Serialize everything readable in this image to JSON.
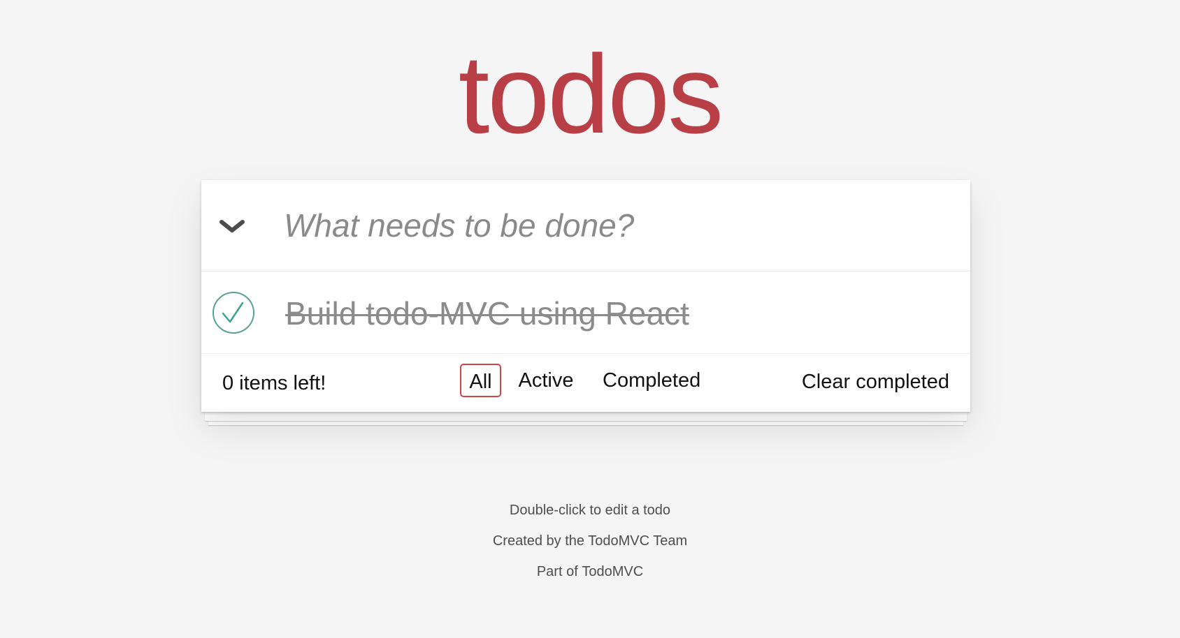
{
  "header": {
    "title": "todos",
    "new_todo_placeholder": "What needs to be done?",
    "toggle_all_icon": "chevron-down-icon"
  },
  "todos": [
    {
      "title": "Build todo-MVC using React",
      "completed": true,
      "check_icon": "checkmark-circle-icon"
    }
  ],
  "footer": {
    "count_text": "0 items left!",
    "filters": [
      {
        "label": "All",
        "selected": true
      },
      {
        "label": "Active",
        "selected": false
      },
      {
        "label": "Completed",
        "selected": false
      }
    ],
    "clear_completed_label": "Clear completed"
  },
  "info": {
    "hint": "Double-click to edit a todo",
    "credit": "Created by the TodoMVC Team",
    "part_of_prefix": "Part of ",
    "part_of_link": "TodoMVC"
  },
  "colors": {
    "title": "#b83f45",
    "check": "#5dc2af",
    "filter_selected_border": "#ce4646",
    "background": "#f5f5f5"
  }
}
